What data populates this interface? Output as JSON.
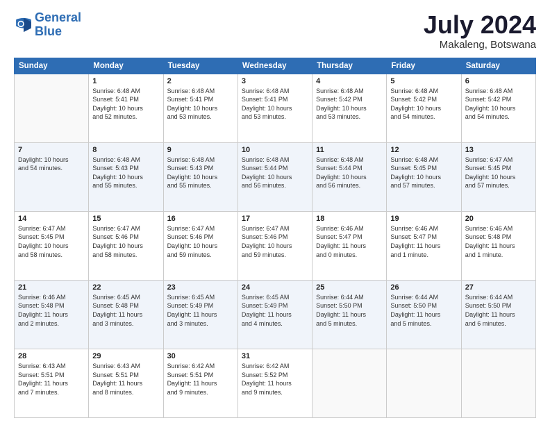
{
  "logo": {
    "line1": "General",
    "line2": "Blue"
  },
  "title": "July 2024",
  "subtitle": "Makaleng, Botswana",
  "headers": [
    "Sunday",
    "Monday",
    "Tuesday",
    "Wednesday",
    "Thursday",
    "Friday",
    "Saturday"
  ],
  "weeks": [
    [
      {
        "day": "",
        "info": ""
      },
      {
        "day": "1",
        "info": "Sunrise: 6:48 AM\nSunset: 5:41 PM\nDaylight: 10 hours\nand 52 minutes."
      },
      {
        "day": "2",
        "info": "Sunrise: 6:48 AM\nSunset: 5:41 PM\nDaylight: 10 hours\nand 53 minutes."
      },
      {
        "day": "3",
        "info": "Sunrise: 6:48 AM\nSunset: 5:41 PM\nDaylight: 10 hours\nand 53 minutes."
      },
      {
        "day": "4",
        "info": "Sunrise: 6:48 AM\nSunset: 5:42 PM\nDaylight: 10 hours\nand 53 minutes."
      },
      {
        "day": "5",
        "info": "Sunrise: 6:48 AM\nSunset: 5:42 PM\nDaylight: 10 hours\nand 54 minutes."
      },
      {
        "day": "6",
        "info": "Sunrise: 6:48 AM\nSunset: 5:42 PM\nDaylight: 10 hours\nand 54 minutes."
      }
    ],
    [
      {
        "day": "7",
        "info": "Daylight: 10 hours\nand 54 minutes."
      },
      {
        "day": "8",
        "info": "Sunrise: 6:48 AM\nSunset: 5:43 PM\nDaylight: 10 hours\nand 55 minutes."
      },
      {
        "day": "9",
        "info": "Sunrise: 6:48 AM\nSunset: 5:43 PM\nDaylight: 10 hours\nand 55 minutes."
      },
      {
        "day": "10",
        "info": "Sunrise: 6:48 AM\nSunset: 5:44 PM\nDaylight: 10 hours\nand 56 minutes."
      },
      {
        "day": "11",
        "info": "Sunrise: 6:48 AM\nSunset: 5:44 PM\nDaylight: 10 hours\nand 56 minutes."
      },
      {
        "day": "12",
        "info": "Sunrise: 6:48 AM\nSunset: 5:45 PM\nDaylight: 10 hours\nand 57 minutes."
      },
      {
        "day": "13",
        "info": "Sunrise: 6:47 AM\nSunset: 5:45 PM\nDaylight: 10 hours\nand 57 minutes."
      }
    ],
    [
      {
        "day": "14",
        "info": "Sunrise: 6:47 AM\nSunset: 5:45 PM\nDaylight: 10 hours\nand 58 minutes."
      },
      {
        "day": "15",
        "info": "Sunrise: 6:47 AM\nSunset: 5:46 PM\nDaylight: 10 hours\nand 58 minutes."
      },
      {
        "day": "16",
        "info": "Sunrise: 6:47 AM\nSunset: 5:46 PM\nDaylight: 10 hours\nand 59 minutes."
      },
      {
        "day": "17",
        "info": "Sunrise: 6:47 AM\nSunset: 5:46 PM\nDaylight: 10 hours\nand 59 minutes."
      },
      {
        "day": "18",
        "info": "Sunrise: 6:46 AM\nSunset: 5:47 PM\nDaylight: 11 hours\nand 0 minutes."
      },
      {
        "day": "19",
        "info": "Sunrise: 6:46 AM\nSunset: 5:47 PM\nDaylight: 11 hours\nand 1 minute."
      },
      {
        "day": "20",
        "info": "Sunrise: 6:46 AM\nSunset: 5:48 PM\nDaylight: 11 hours\nand 1 minute."
      }
    ],
    [
      {
        "day": "21",
        "info": "Sunrise: 6:46 AM\nSunset: 5:48 PM\nDaylight: 11 hours\nand 2 minutes."
      },
      {
        "day": "22",
        "info": "Sunrise: 6:45 AM\nSunset: 5:48 PM\nDaylight: 11 hours\nand 3 minutes."
      },
      {
        "day": "23",
        "info": "Sunrise: 6:45 AM\nSunset: 5:49 PM\nDaylight: 11 hours\nand 3 minutes."
      },
      {
        "day": "24",
        "info": "Sunrise: 6:45 AM\nSunset: 5:49 PM\nDaylight: 11 hours\nand 4 minutes."
      },
      {
        "day": "25",
        "info": "Sunrise: 6:44 AM\nSunset: 5:50 PM\nDaylight: 11 hours\nand 5 minutes."
      },
      {
        "day": "26",
        "info": "Sunrise: 6:44 AM\nSunset: 5:50 PM\nDaylight: 11 hours\nand 5 minutes."
      },
      {
        "day": "27",
        "info": "Sunrise: 6:44 AM\nSunset: 5:50 PM\nDaylight: 11 hours\nand 6 minutes."
      }
    ],
    [
      {
        "day": "28",
        "info": "Sunrise: 6:43 AM\nSunset: 5:51 PM\nDaylight: 11 hours\nand 7 minutes."
      },
      {
        "day": "29",
        "info": "Sunrise: 6:43 AM\nSunset: 5:51 PM\nDaylight: 11 hours\nand 8 minutes."
      },
      {
        "day": "30",
        "info": "Sunrise: 6:42 AM\nSunset: 5:51 PM\nDaylight: 11 hours\nand 9 minutes."
      },
      {
        "day": "31",
        "info": "Sunrise: 6:42 AM\nSunset: 5:52 PM\nDaylight: 11 hours\nand 9 minutes."
      },
      {
        "day": "",
        "info": ""
      },
      {
        "day": "",
        "info": ""
      },
      {
        "day": "",
        "info": ""
      }
    ]
  ]
}
